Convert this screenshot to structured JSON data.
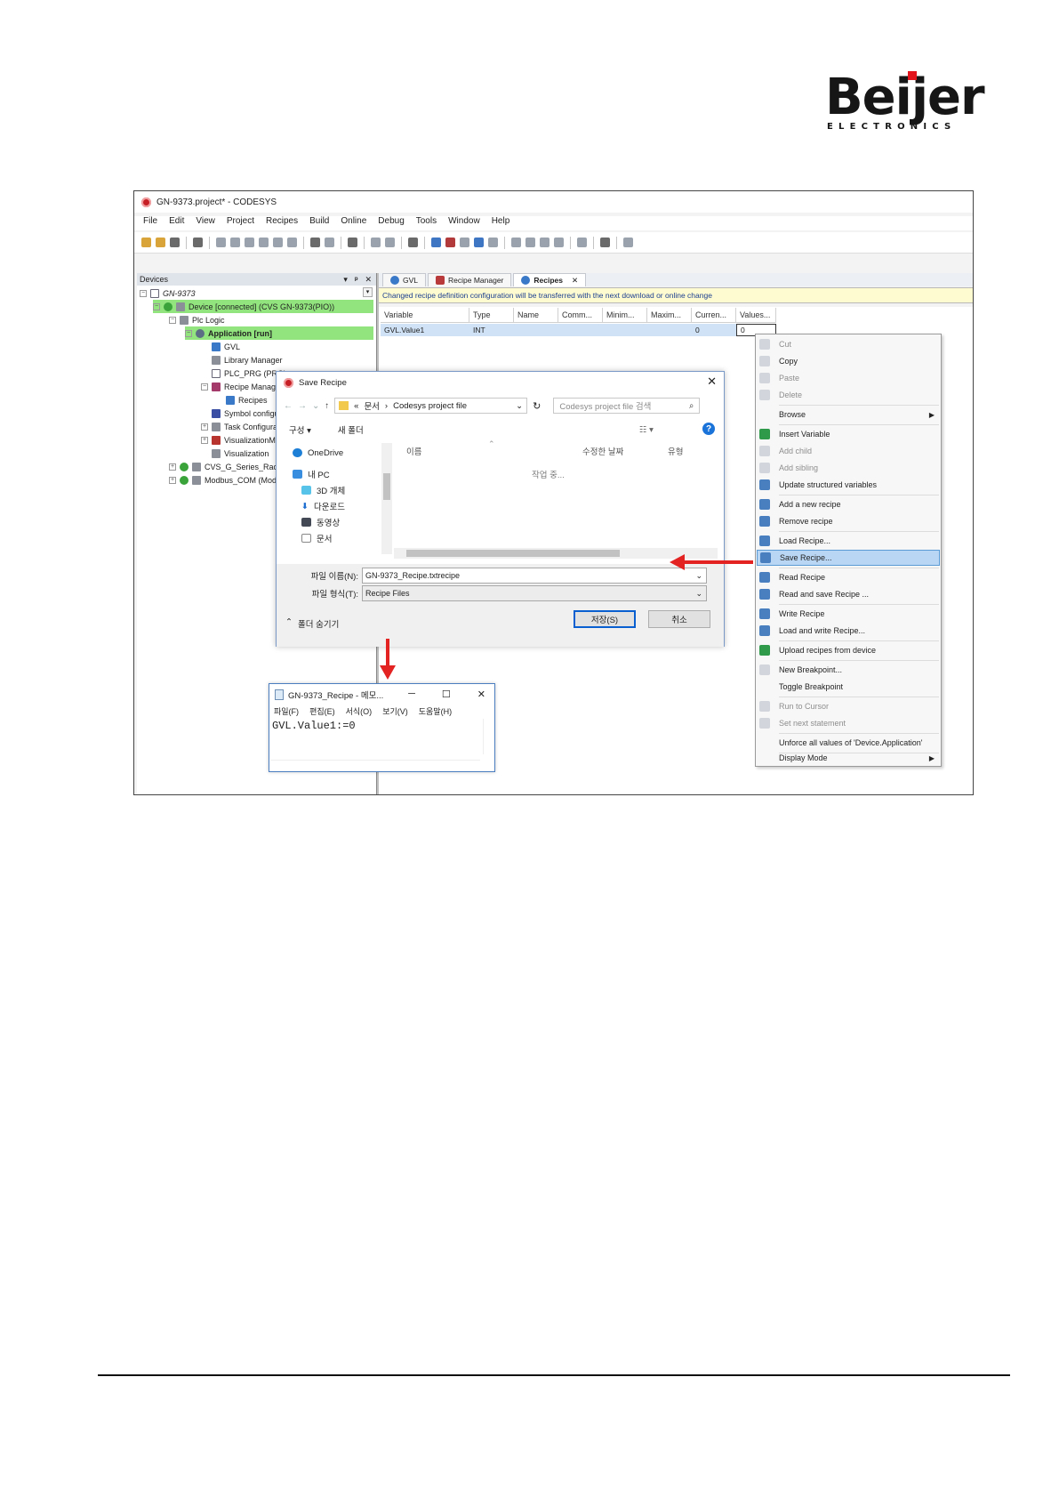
{
  "logo": {
    "word": "Beijer",
    "sub": "ELECTRONICS",
    "accent": "#e3141b"
  },
  "window": {
    "title": "GN-9373.project* - CODESYS",
    "menu": [
      "File",
      "Edit",
      "View",
      "Project",
      "Recipes",
      "Build",
      "Online",
      "Debug",
      "Tools",
      "Window",
      "Help"
    ]
  },
  "devices": {
    "header": "Devices",
    "header_controls": [
      "▾",
      "ᵖ",
      "✕"
    ],
    "tree": [
      {
        "label": "GN-9373",
        "italic": true
      },
      {
        "label": "Device [connected] (CVS GN-9373(PIO))",
        "highlight": true
      },
      {
        "label": "Plc Logic"
      },
      {
        "label": "Application [run]",
        "highlight": true,
        "bold": true
      },
      {
        "label": "GVL"
      },
      {
        "label": "Library Manager"
      },
      {
        "label": "PLC_PRG (PRG)"
      },
      {
        "label": "Recipe Manager"
      },
      {
        "label": "Recipes"
      },
      {
        "label": "Symbol configuration"
      },
      {
        "label": "Task Configuration"
      },
      {
        "label": "VisualizationManager"
      },
      {
        "label": "Visualization"
      },
      {
        "label": "CVS_G_Series_Rack"
      },
      {
        "label": "Modbus_COM (Modbus COM)"
      }
    ]
  },
  "tabs": [
    {
      "label": "GVL",
      "active": false
    },
    {
      "label": "Recipe Manager",
      "active": false
    },
    {
      "label": "Recipes",
      "active": true,
      "close": "✕"
    }
  ],
  "notice": "Changed recipe definition configuration will be transferred with the next download or online change",
  "grid": {
    "columns": [
      "Variable",
      "Type",
      "Name",
      "Comm...",
      "Minim...",
      "Maxim...",
      "Curren...",
      "Values..."
    ],
    "row": [
      "GVL.Value1",
      "INT",
      "",
      "",
      "",
      "",
      "0",
      "0"
    ]
  },
  "context_menu": [
    {
      "label": "Cut",
      "disabled": true
    },
    {
      "label": "Copy"
    },
    {
      "label": "Paste",
      "disabled": true
    },
    {
      "label": "Delete",
      "disabled": true
    },
    {
      "label": "Browse",
      "submenu": true
    },
    {
      "label": "Insert Variable"
    },
    {
      "label": "Add child",
      "disabled": true
    },
    {
      "label": "Add sibling",
      "disabled": true
    },
    {
      "label": "Update structured variables"
    },
    {
      "label": "Add a new recipe"
    },
    {
      "label": "Remove recipe"
    },
    {
      "label": "Load Recipe..."
    },
    {
      "label": "Save Recipe...",
      "selected": true
    },
    {
      "label": "Read Recipe"
    },
    {
      "label": "Read and save Recipe ..."
    },
    {
      "label": "Write Recipe"
    },
    {
      "label": "Load and write Recipe..."
    },
    {
      "label": "Upload recipes from device"
    },
    {
      "label": "New Breakpoint..."
    },
    {
      "label": "Toggle Breakpoint"
    },
    {
      "label": "Run to Cursor",
      "disabled": true
    },
    {
      "label": "Set next statement",
      "disabled": true
    },
    {
      "label": "Unforce all values of 'Device.Application'"
    },
    {
      "label": "Display Mode",
      "submenu": true
    }
  ],
  "save_dialog": {
    "title": "Save Recipe",
    "close": "✕",
    "path": [
      "«",
      "문서",
      "›",
      "Codesys project file"
    ],
    "search_placeholder": "Codesys project file 검색",
    "organize": "구성 ▾",
    "new_folder": "새 폴더",
    "nav": [
      "OneDrive",
      "내 PC",
      "3D 개체",
      "다운로드",
      "동영상",
      "문서"
    ],
    "columns": [
      "이름",
      "수정한 날짜",
      "유형"
    ],
    "working": "작업 중...",
    "filename_label": "파일 이름(N):",
    "filename_value": "GN-9373_Recipe.txtrecipe",
    "filetype_label": "파일 형식(T):",
    "filetype_value": "Recipe Files",
    "hide_folders": "폴더 숨기기",
    "save": "저장(S)",
    "cancel": "취소"
  },
  "notepad": {
    "title": "GN-9373_Recipe - 메모...",
    "menu": [
      "파일(F)",
      "편집(E)",
      "서식(O)",
      "보기(V)",
      "도움말(H)"
    ],
    "content": "GVL.Value1:=0"
  }
}
